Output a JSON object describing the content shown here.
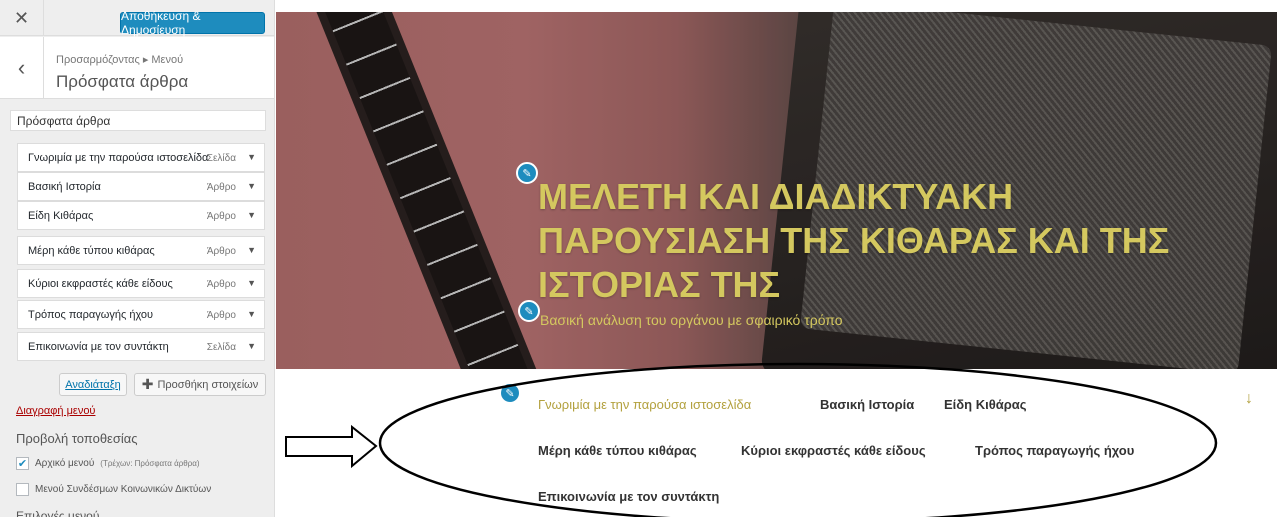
{
  "panel": {
    "close_icon_glyph": "✕",
    "publish_label": "Αποθήκευση & Δημοσίευση",
    "back_icon_glyph": "‹",
    "breadcrumb": "Προσαρμόζοντας ▸ Μενού",
    "section_title": "Πρόσφατα άρθρα",
    "menu_name_value": "Πρόσφατα άρθρα",
    "menu_items": [
      {
        "label": "Γνωριμία με την παρούσα ιστοσελίδα",
        "type": "Σελίδα"
      },
      {
        "label": "Βασική Ιστορία",
        "type": "Άρθρο"
      },
      {
        "label": "Είδη Κιθάρας",
        "type": "Άρθρο"
      },
      {
        "label": "Μέρη κάθε τύπου κιθάρας",
        "type": "Άρθρο"
      },
      {
        "label": "Κύριοι εκφραστές κάθε είδους",
        "type": "Άρθρο"
      },
      {
        "label": "Τρόπος παραγωγής ήχου",
        "type": "Άρθρο"
      },
      {
        "label": "Επικοινωνία με τον συντάκτη",
        "type": "Σελίδα"
      }
    ],
    "reorder_label": "Αναδιάταξη",
    "add_items_label": "Προσθήκη στοιχείων",
    "delete_menu_label": "Διαγραφή μενού",
    "locations_title": "Προβολή τοποθεσίας",
    "locations": [
      {
        "label": "Αρχικό μενού",
        "sub": "(Τρέχων: Πρόσφατα άρθρα)",
        "checked": true
      },
      {
        "label": "Μενού Συνδέσμων Κοινωνικών Δικτύων",
        "sub": "",
        "checked": false
      }
    ],
    "menu_options_title": "Επιλογές μενού"
  },
  "preview": {
    "site_title": "ΜΕΛΕΤΗ ΚΑΙ ΔΙΑΔΙΚΤΥΑΚΗ ΠΑΡΟΥΣΙΑΣΗ ΤΗΣ ΚΙΘΑΡΑΣ ΚΑΙ ΤΗΣ ΙΣΤΟΡΙΑΣ ΤΗΣ",
    "site_tagline": "Βασική ανάλυση του οργάνου με σφαιρικό τρόπο",
    "nav": [
      "Γνωριμία με την παρούσα ιστοσελίδα",
      "Βασική Ιστορία",
      "Είδη Κιθάρας",
      "Μέρη κάθε τύπου κιθάρας",
      "Κύριοι εκφραστές κάθε είδους",
      "Τρόπος παραγωγής ήχου",
      "Επικοινωνία με τον συντάκτη"
    ],
    "scroll_arrow_glyph": "↓",
    "edit_icon_glyph": "✎"
  },
  "colors": {
    "accent": "#1e8cbe",
    "title_gold": "#d4c85f",
    "nav_active": "#b3a13e",
    "delete_red": "#a00000"
  }
}
